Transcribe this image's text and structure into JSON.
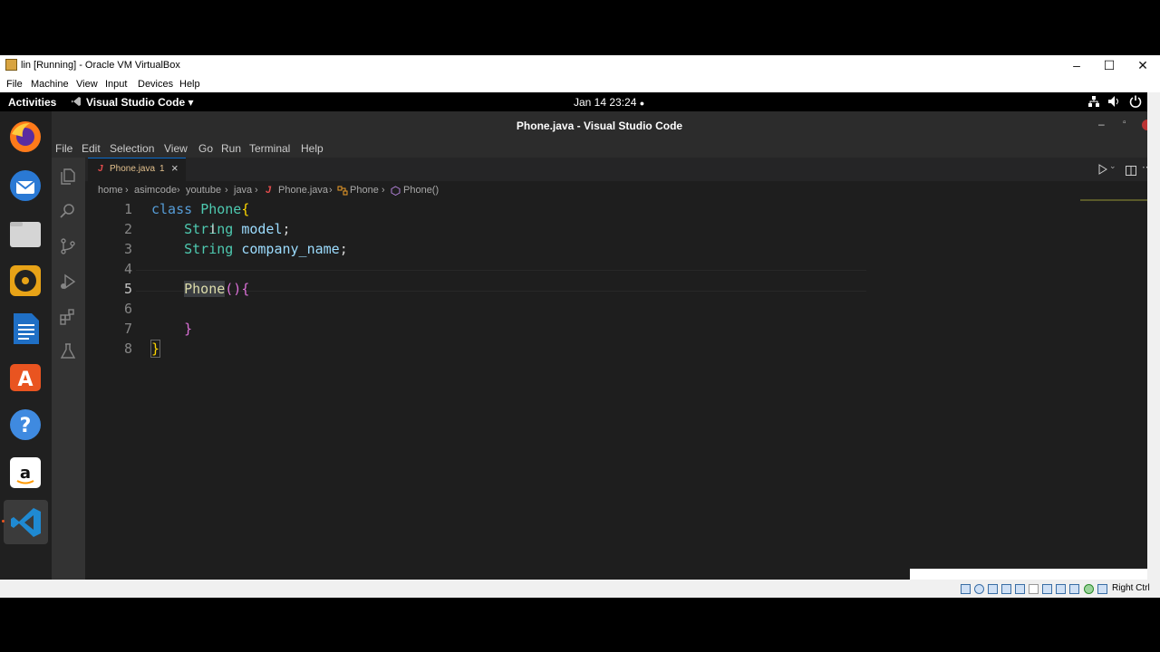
{
  "vbox": {
    "window_title": "lin [Running] - Oracle VM VirtualBox",
    "controls": {
      "minimize": "–",
      "maximize": "☐",
      "close": "✕"
    },
    "menu": [
      "File",
      "Machine",
      "View",
      "Input",
      "Devices",
      "Help"
    ],
    "host_key": "Right Ctrl"
  },
  "gnome": {
    "activities": "Activities",
    "app_name": "Visual Studio Code",
    "app_menu_arrow": "▾",
    "datetime": "Jan 14  23:24",
    "record_dot": "●",
    "tray_icons": [
      "network-icon",
      "volume-icon",
      "power-icon"
    ]
  },
  "dock": {
    "items": [
      "firefox-icon",
      "thunderbird-icon",
      "files-icon",
      "rhythmbox-icon",
      "libreoffice-writer-icon",
      "software-icon",
      "help-icon",
      "amazon-icon",
      "vscode-icon"
    ]
  },
  "vscode": {
    "title": "Phone.java - Visual Studio Code",
    "menu": [
      "File",
      "Edit",
      "Selection",
      "View",
      "Go",
      "Run",
      "Terminal",
      "Help"
    ],
    "tab": {
      "icon": "J",
      "label": "Phone.java",
      "badge": "1",
      "close": "×"
    },
    "breadcrumb": [
      "home",
      "asimcode",
      "youtube",
      "java",
      "Phone.java",
      "Phone",
      "Phone()"
    ],
    "breadcrumb_sep": "›",
    "line_numbers": [
      "1",
      "2",
      "3",
      "4",
      "5",
      "6",
      "7",
      "8"
    ],
    "code": {
      "l1": {
        "kw": "class",
        "name": "Phone",
        "brace": "{"
      },
      "l2": {
        "type": "String",
        "var": "model",
        "semi": ";"
      },
      "l3": {
        "type": "String",
        "var": "company_name",
        "semi": ";"
      },
      "l5": {
        "fn": "Phone",
        "parens": "()",
        "brace": "{"
      },
      "l7": {
        "brace": "}"
      },
      "l8": {
        "brace": "}"
      }
    },
    "accent": "#0a6ccf"
  }
}
